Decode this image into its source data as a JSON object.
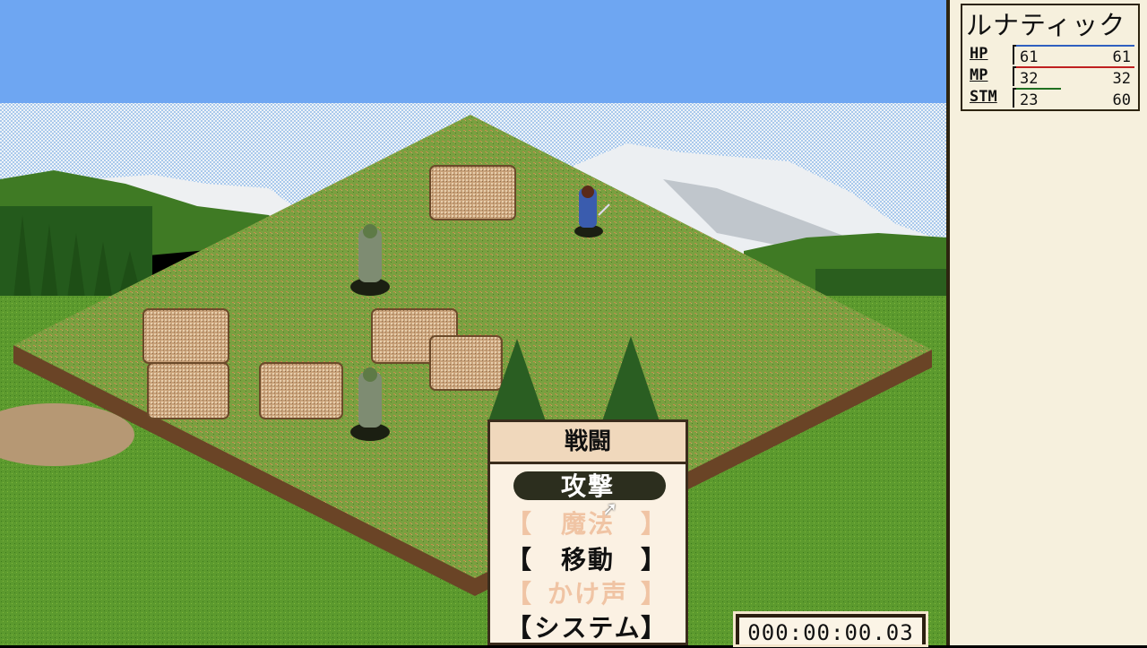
{
  "character": {
    "name": "ルナティック",
    "stats": [
      {
        "label": "HP",
        "current": "61",
        "max": "61",
        "color": "#3060c0"
      },
      {
        "label": "MP",
        "current": "32",
        "max": "32",
        "color": "#c02020"
      },
      {
        "label": "STM",
        "current": "23",
        "max": "60",
        "color": "#207020",
        "fraction": 0.38
      }
    ]
  },
  "menu": {
    "title": "戦闘",
    "items": [
      {
        "label": "攻撃",
        "state": "selected"
      },
      {
        "label": "魔法",
        "state": "disabled"
      },
      {
        "label": "移動",
        "state": "enabled"
      },
      {
        "label": "かけ声",
        "state": "disabled"
      },
      {
        "label": "システム",
        "state": "enabled"
      }
    ],
    "bracket_left": "【",
    "bracket_right": "】"
  },
  "timer": "000:00:00.03",
  "colors": {
    "sky": "#6ea6f2",
    "grass": "#6c9a36",
    "panel": "#f6f0dd",
    "menu_head": "#f0d8bc",
    "menu_body": "#fbf1e3",
    "selected_pill": "#2c2e1e"
  },
  "icons": [
    "pointer-cursor-icon"
  ]
}
